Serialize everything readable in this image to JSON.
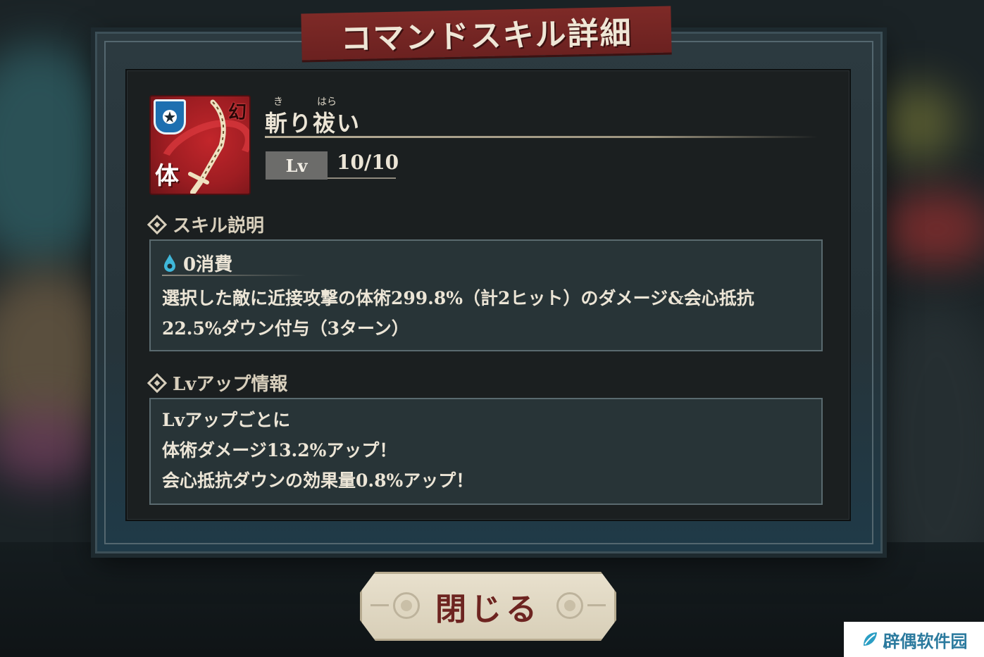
{
  "dialog": {
    "title": "コマンドスキル詳細"
  },
  "skill": {
    "ruby_1": "き",
    "ruby_2": "はら",
    "name": "斬り祓い",
    "icon_attribute_label": "体",
    "icon_corner_mark": "幻",
    "level_label": "Lv",
    "level_value": "10/10"
  },
  "skill_description": {
    "heading": "スキル説明",
    "cost": "0消費",
    "lines": [
      "選択した敵に近接攻撃の体術299.8%（計2ヒット）のダメージ&会心抵抗",
      "22.5%ダウン付与（3ターン）"
    ]
  },
  "level_up_info": {
    "heading": "Lvアップ情報",
    "lines": [
      "Lvアップごとに",
      "体術ダメージ13.2%アップ！",
      "会心抵抗ダウンの効果量0.8%アップ！"
    ]
  },
  "buttons": {
    "close": "閉じる"
  },
  "watermark": {
    "text": "辟偶软件园"
  },
  "icons": {
    "skill_icon": "katana-skill-icon",
    "shield": "shield-star-icon",
    "cost": "water-drop-icon",
    "section_marker": "diamond-icon"
  },
  "colors": {
    "title_banner": "#7e2a27",
    "skill_icon_bg": "#b3232a",
    "panel_bg": "#1b1f20",
    "box_bg": "#283437",
    "close_text": "#6d2420",
    "cost_drop": "#3fb7d9"
  }
}
